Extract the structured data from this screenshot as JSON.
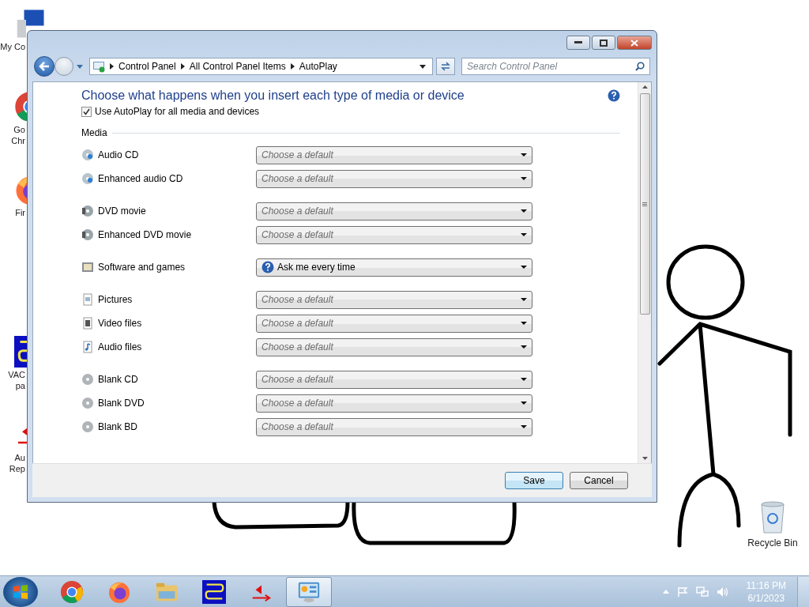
{
  "desktop_icons": [
    {
      "kind": "computer",
      "lines": [
        "My Co"
      ]
    },
    {
      "kind": "chrome",
      "lines": [
        "Go",
        "Chr"
      ]
    },
    {
      "kind": "firefox",
      "lines": [
        "Fir"
      ]
    },
    {
      "kind": "vac",
      "lines": [
        "VAC",
        "pa"
      ]
    },
    {
      "kind": "arrow",
      "lines": [
        "Au",
        "Rep"
      ]
    }
  ],
  "recycle_bin": {
    "label": "Recycle Bin"
  },
  "window": {
    "breadcrumb": [
      "Control Panel",
      "All Control Panel Items",
      "AutoPlay"
    ],
    "search": {
      "placeholder": "Search Control Panel"
    },
    "heading": "Choose what happens when you insert each type of media or device",
    "use_autoplay": {
      "label": "Use AutoPlay for all media and devices",
      "checked": true
    },
    "section": "Media",
    "groups": [
      [
        {
          "kind": "audio-cd",
          "label": "Audio CD",
          "placeholder": "Choose a default"
        },
        {
          "kind": "audio-cd",
          "label": "Enhanced audio CD",
          "placeholder": "Choose a default"
        }
      ],
      [
        {
          "kind": "dvd",
          "label": "DVD movie",
          "placeholder": "Choose a default"
        },
        {
          "kind": "dvd",
          "label": "Enhanced DVD movie",
          "placeholder": "Choose a default"
        }
      ],
      [
        {
          "kind": "software",
          "label": "Software and games",
          "value": "Ask me every time"
        }
      ],
      [
        {
          "kind": "pictures",
          "label": "Pictures",
          "placeholder": "Choose a default"
        },
        {
          "kind": "video",
          "label": "Video files",
          "placeholder": "Choose a default"
        },
        {
          "kind": "audio",
          "label": "Audio files",
          "placeholder": "Choose a default"
        }
      ],
      [
        {
          "kind": "blank",
          "label": "Blank CD",
          "placeholder": "Choose a default"
        },
        {
          "kind": "blank",
          "label": "Blank DVD",
          "placeholder": "Choose a default"
        },
        {
          "kind": "blank",
          "label": "Blank BD",
          "placeholder": "Choose a default"
        }
      ]
    ],
    "buttons": [
      {
        "label": "Save",
        "selected": true
      },
      {
        "label": "Cancel",
        "selected": false
      }
    ]
  },
  "taskbar": {
    "apps": [
      {
        "kind": "chrome",
        "selected": false
      },
      {
        "kind": "firefox",
        "selected": false
      },
      {
        "kind": "folder",
        "selected": false
      },
      {
        "kind": "vac",
        "selected": false
      },
      {
        "kind": "arrow",
        "selected": false
      },
      {
        "kind": "control-panel",
        "selected": true
      }
    ],
    "time": "11:16 PM",
    "date": "6/1/2023"
  }
}
